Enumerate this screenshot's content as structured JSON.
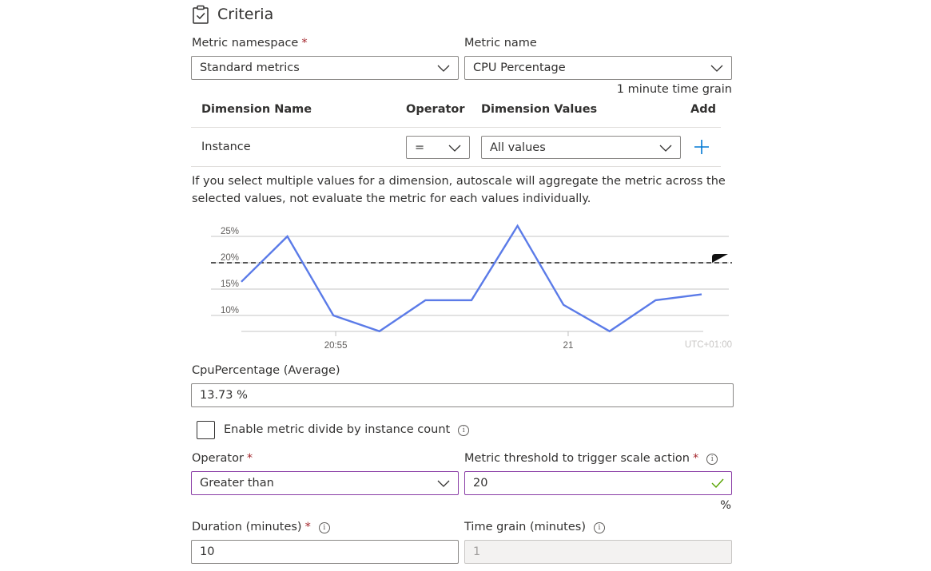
{
  "section": {
    "title": "Criteria",
    "icon": "clipboard-check-icon"
  },
  "metric_namespace": {
    "label": "Metric namespace",
    "required": "*",
    "value": "Standard metrics"
  },
  "metric_name": {
    "label": "Metric name",
    "value": "CPU Percentage",
    "hint": "1 minute time grain"
  },
  "dimensions": {
    "headers": {
      "name": "Dimension Name",
      "operator": "Operator",
      "values": "Dimension Values",
      "add": "Add"
    },
    "rows": [
      {
        "name": "Instance",
        "operator": "=",
        "values": "All values"
      }
    ],
    "note": "If you select multiple values for a dimension, autoscale will aggregate the metric across the selected values, not evaluate the metric for each values individually."
  },
  "chart_data": {
    "type": "line",
    "title": "",
    "xlabel": "",
    "ylabel": "",
    "y_ticks": [
      "25%",
      "20%",
      "15%",
      "10%"
    ],
    "y_tick_values": [
      25,
      20,
      15,
      10
    ],
    "ylim": [
      7,
      27
    ],
    "x_ticks": [
      {
        "label": "20:55",
        "index": 2.05
      },
      {
        "label": "21",
        "index": 7.1
      }
    ],
    "timezone": "UTC+01:00",
    "series": [
      {
        "name": "CpuPercentage (Average)",
        "color": "#5b7be8",
        "values": [
          16.4,
          25.0,
          10.0,
          7.0,
          12.9,
          12.9,
          27.0,
          12.0,
          7.0,
          12.9,
          14.0
        ]
      }
    ],
    "threshold": {
      "value": 20,
      "style": "dashed",
      "color": "#000000"
    },
    "grid": true,
    "legend": "none"
  },
  "current_value": {
    "label": "CpuPercentage (Average)",
    "value": "13.73 %"
  },
  "divide_by_instance": {
    "label": "Enable metric divide by instance count",
    "checked": false
  },
  "operator": {
    "label": "Operator",
    "required": "*",
    "value": "Greater than"
  },
  "threshold": {
    "label": "Metric threshold to trigger scale action",
    "required": "*",
    "value": "20",
    "unit": "%",
    "valid": true
  },
  "duration": {
    "label": "Duration (minutes)",
    "required": "*",
    "value": "10"
  },
  "time_grain": {
    "label": "Time grain (minutes)",
    "value": "1",
    "disabled": true
  },
  "info_glyph": "i"
}
